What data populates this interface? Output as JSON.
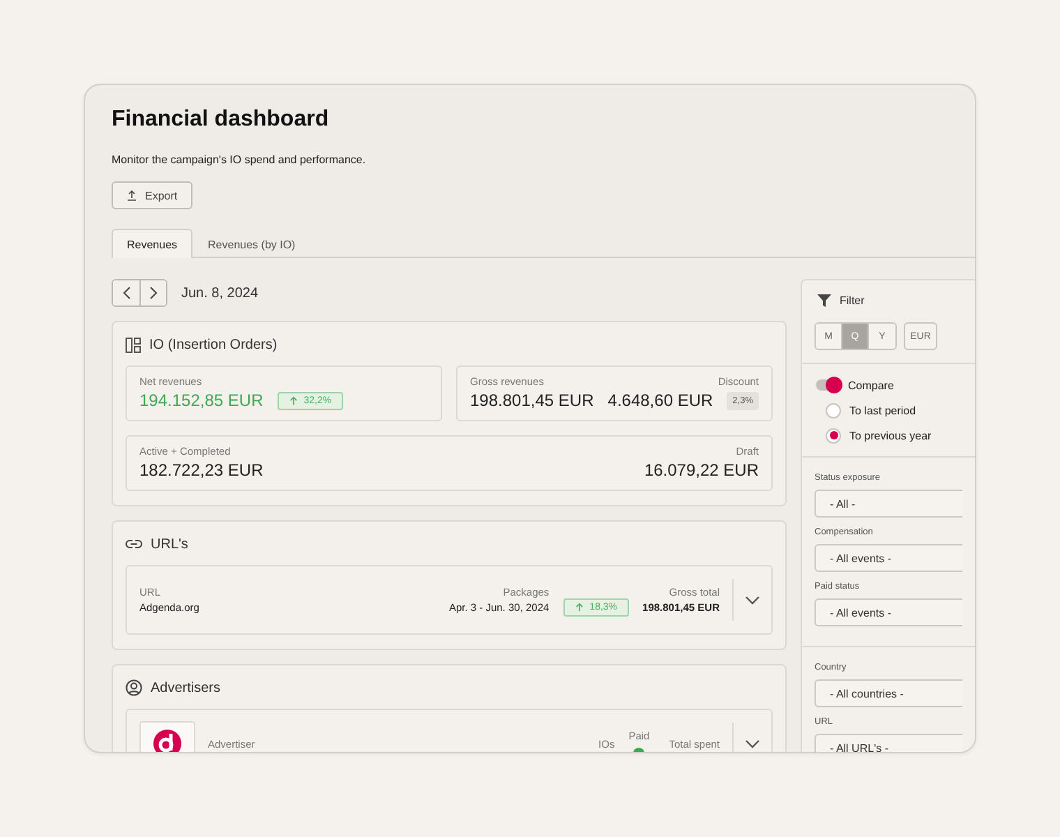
{
  "window": {
    "title": "Financial dashboard",
    "subtitle": "Monitor the campaign's IO spend and performance."
  },
  "export_button": "Export",
  "tabs": [
    {
      "label": "Revenues",
      "selected": true
    },
    {
      "label": "Revenues (by IO)",
      "selected": false
    }
  ],
  "date": "Jun. 8, 2024",
  "io_section": {
    "title": "IO (Insertion Orders)",
    "net": {
      "label": "Net revenues",
      "value": "194.152,85 EUR",
      "change": "32,2%"
    },
    "gross": {
      "label": "Gross revenues",
      "value": "198.801,45 EUR",
      "discount_label": "Discount",
      "discount_value": "4.648,60 EUR",
      "discount_pct": "2,3%"
    },
    "active": {
      "label": "Active + Completed",
      "value": "182.722,23 EUR",
      "draft_label": "Draft",
      "draft_value": "16.079,22 EUR"
    }
  },
  "urls_section": {
    "title": "URL's",
    "rows": [
      {
        "url_label": "URL",
        "url": "Adgenda.org",
        "packages_label": "Packages",
        "packages": "Apr. 3 - Jun. 30, 2024",
        "change": "18,3%",
        "gross_label": "Gross total",
        "gross": "198.801,45 EUR"
      }
    ]
  },
  "advertisers_section": {
    "title": "Advertisers",
    "rows": [
      {
        "label": "Advertiser",
        "ios_label": "IOs",
        "paid_label": "Paid",
        "paid": true,
        "total_label": "Total spent"
      }
    ]
  },
  "filter": {
    "title": "Filter",
    "periods": [
      {
        "label": "M",
        "selected": false
      },
      {
        "label": "Q",
        "selected": true
      },
      {
        "label": "Y",
        "selected": false
      }
    ],
    "currency": "EUR",
    "compare": {
      "label": "Compare",
      "on": true
    },
    "compare_options": [
      {
        "label": "To last period",
        "selected": false
      },
      {
        "label": "To previous year",
        "selected": true
      }
    ],
    "select_groups": [
      [
        {
          "label": "Status exposure",
          "value": "- All -"
        },
        {
          "label": "Compensation",
          "value": "- All events -"
        },
        {
          "label": "Paid status",
          "value": "- All events -"
        }
      ],
      [
        {
          "label": "Country",
          "value": "- All countries -"
        },
        {
          "label": "URL",
          "value": "- All URL's -"
        }
      ]
    ]
  }
}
